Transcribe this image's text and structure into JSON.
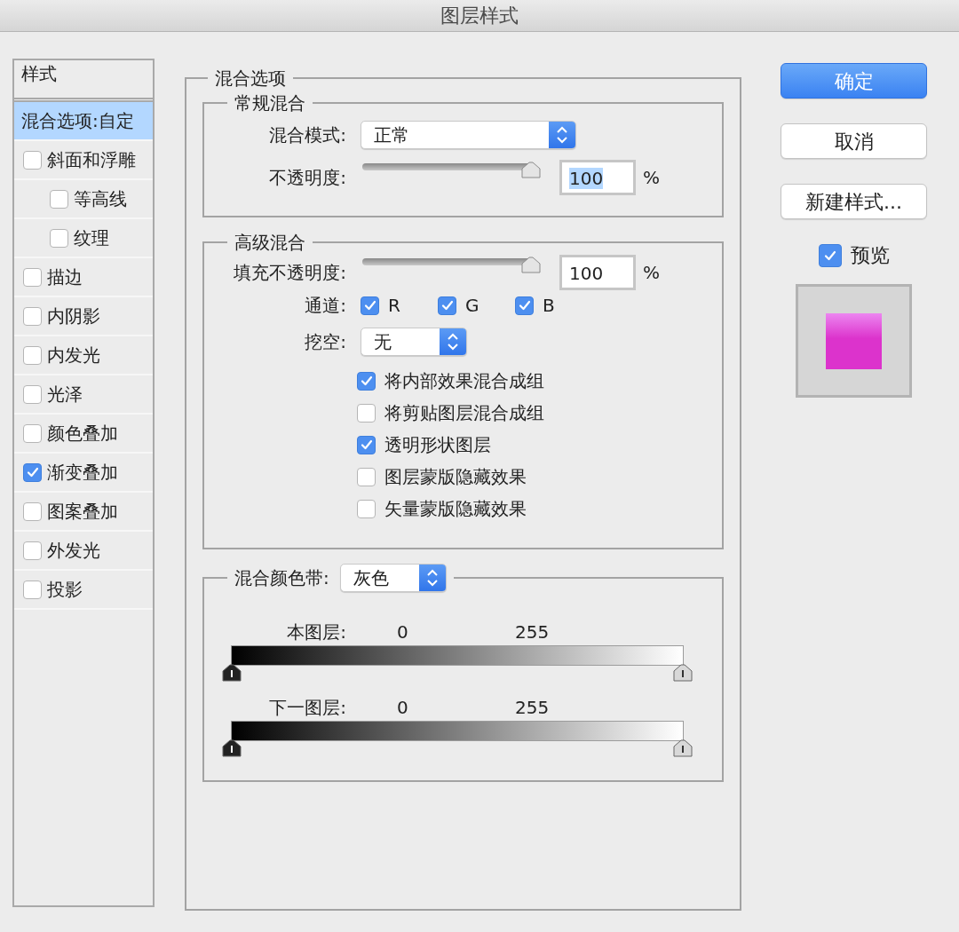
{
  "window": {
    "title": "图层样式"
  },
  "sidebar": {
    "header": "样式",
    "items": [
      {
        "label": "混合选项:自定",
        "kind": "option",
        "selected": true
      },
      {
        "label": "斜面和浮雕",
        "kind": "checkbox",
        "checked": false,
        "selected": false,
        "children": [
          {
            "label": "等高线",
            "kind": "checkbox",
            "checked": false,
            "selected": false
          },
          {
            "label": "纹理",
            "kind": "checkbox",
            "checked": false,
            "selected": false
          }
        ]
      },
      {
        "label": "描边",
        "kind": "checkbox",
        "checked": false,
        "selected": false
      },
      {
        "label": "内阴影",
        "kind": "checkbox",
        "checked": false,
        "selected": false
      },
      {
        "label": "内发光",
        "kind": "checkbox",
        "checked": false,
        "selected": false
      },
      {
        "label": "光泽",
        "kind": "checkbox",
        "checked": false,
        "selected": false
      },
      {
        "label": "颜色叠加",
        "kind": "checkbox",
        "checked": false,
        "selected": false
      },
      {
        "label": "渐变叠加",
        "kind": "checkbox",
        "checked": true,
        "selected": false
      },
      {
        "label": "图案叠加",
        "kind": "checkbox",
        "checked": false,
        "selected": false
      },
      {
        "label": "外发光",
        "kind": "checkbox",
        "checked": false,
        "selected": false
      },
      {
        "label": "投影",
        "kind": "checkbox",
        "checked": false,
        "selected": false
      }
    ]
  },
  "blend_options": {
    "title": "混合选项",
    "general": {
      "title": "常规混合",
      "mode_label": "混合模式:",
      "mode_value": "正常",
      "opacity": {
        "label": "不透明度:",
        "level": 1,
        "value": "100",
        "value_selected": true,
        "unit": "%"
      }
    },
    "advanced": {
      "title": "高级混合",
      "fill_opacity": {
        "label": "填充不透明度:",
        "level": 1,
        "value": "100",
        "unit": "%"
      },
      "channels_label": "通道:",
      "channels": [
        {
          "label": "R",
          "checked": true
        },
        {
          "label": "G",
          "checked": true
        },
        {
          "label": "B",
          "checked": true
        }
      ],
      "knockout_label": "挖空:",
      "knockout_value": "无",
      "options": [
        {
          "label": "将内部效果混合成组",
          "checked": true
        },
        {
          "label": "将剪贴图层混合成组",
          "checked": false
        },
        {
          "label": "透明形状图层",
          "checked": true
        },
        {
          "label": "图层蒙版隐藏效果",
          "checked": false
        },
        {
          "label": "矢量蒙版隐藏效果",
          "checked": false
        }
      ]
    },
    "blend_if": {
      "label": "混合颜色带:",
      "value": "灰色",
      "bands": [
        {
          "label": "本图层:",
          "low": "0",
          "high": "255"
        },
        {
          "label": "下一图层:",
          "low": "0",
          "high": "255"
        }
      ]
    }
  },
  "buttons": [
    {
      "label": "确定",
      "kind": "primary"
    },
    {
      "label": "取消",
      "kind": "default"
    },
    {
      "label": "新建样式...",
      "kind": "default"
    }
  ],
  "preview": {
    "label": "预览",
    "checked": true
  }
}
